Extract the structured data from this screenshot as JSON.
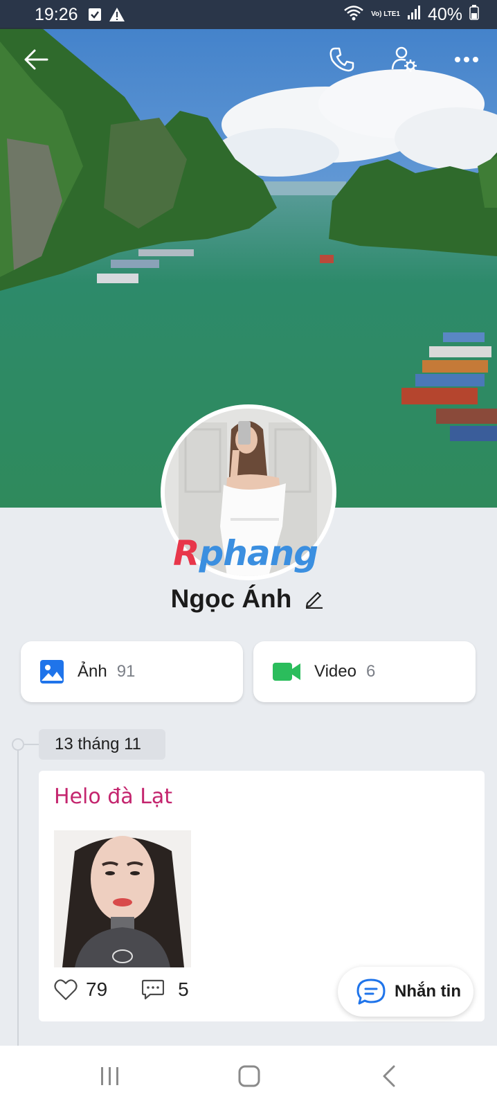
{
  "status_bar": {
    "time": "19:26",
    "battery": "40%",
    "network": "Vo) LTE1",
    "icons": [
      "checkbox-icon",
      "warning-icon",
      "wifi-icon",
      "volte-icon",
      "signal-icon",
      "battery-icon"
    ]
  },
  "top_bar": {
    "icons": [
      "back-arrow-icon",
      "phone-icon",
      "user-settings-icon",
      "more-icon"
    ]
  },
  "profile": {
    "name": "Ngọc Ánh",
    "watermark_part1": "R",
    "watermark_part2": "phang"
  },
  "media": {
    "photos": {
      "label": "Ảnh",
      "count": "91",
      "icon": "image-icon",
      "color": "#1f74ea"
    },
    "videos": {
      "label": "Video",
      "count": "6",
      "icon": "video-camera-icon",
      "color": "#2bbd5c"
    }
  },
  "timeline": {
    "date": "13 tháng 11",
    "post": {
      "text": "Helo đà Lạt",
      "likes": "79",
      "comments": "5"
    }
  },
  "message_button": {
    "label": "Nhắn tin",
    "color": "#1f74ea"
  },
  "nav": {
    "icons": [
      "recent-apps-icon",
      "home-icon",
      "back-icon"
    ]
  }
}
